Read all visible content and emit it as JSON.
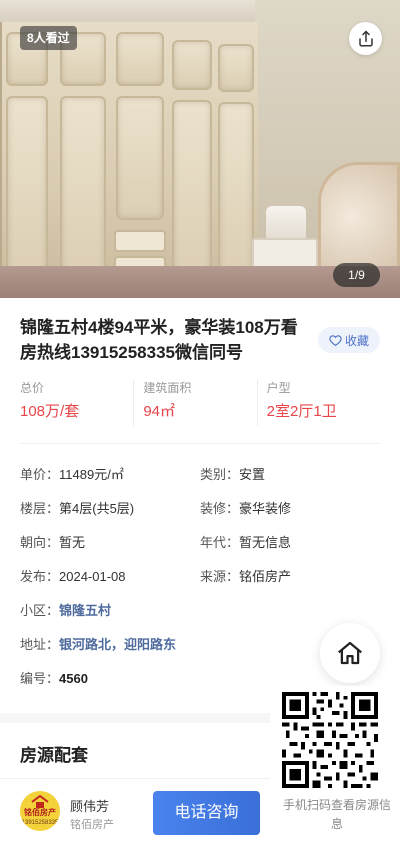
{
  "hero": {
    "views_badge": "8人看过",
    "image_counter": "1/9",
    "share_icon": "share-icon"
  },
  "listing": {
    "title": "锦隆五村4楼94平米，豪华装108万看房热线13915258335微信同号",
    "favorite_label": "收藏",
    "favorite_icon": "heart-outline-icon"
  },
  "stats": [
    {
      "label": "总价",
      "value": "108万/套"
    },
    {
      "label": "建筑面积",
      "value": "94㎡"
    },
    {
      "label": "户型",
      "value": "2室2厅1卫"
    }
  ],
  "details": {
    "unit_price": {
      "key": "单价：",
      "value": "11489元/㎡"
    },
    "category": {
      "key": "类别：",
      "value": "安置"
    },
    "floor": {
      "key": "楼层：",
      "value": "第4层(共5层)"
    },
    "decoration": {
      "key": "装修：",
      "value": "豪华装修"
    },
    "orientation": {
      "key": "朝向：",
      "value": "暂无"
    },
    "year": {
      "key": "年代：",
      "value": "暂无信息"
    },
    "published": {
      "key": "发布：",
      "value": "2024-01-08"
    },
    "source": {
      "key": "来源：",
      "value": "铭佰房产"
    },
    "community": {
      "key": "小区：",
      "value": "锦隆五村"
    },
    "address": {
      "key": "地址：",
      "value": "银河路北，迎阳路东"
    },
    "code": {
      "key": "编号：",
      "value": "4560"
    }
  },
  "section": {
    "facilities_title": "房源配套"
  },
  "qr": {
    "caption": "手机扫码查看房源信息"
  },
  "agent": {
    "logo_brand": "铭佰房产",
    "logo_phone": "13915258335",
    "name": "顾伟芳",
    "company": "铭佰房产",
    "call_label": "电话咨询"
  },
  "colors": {
    "price_red": "#e8454a",
    "accent_blue": "#3a6fd8",
    "link_blue": "#4f6b9e"
  }
}
